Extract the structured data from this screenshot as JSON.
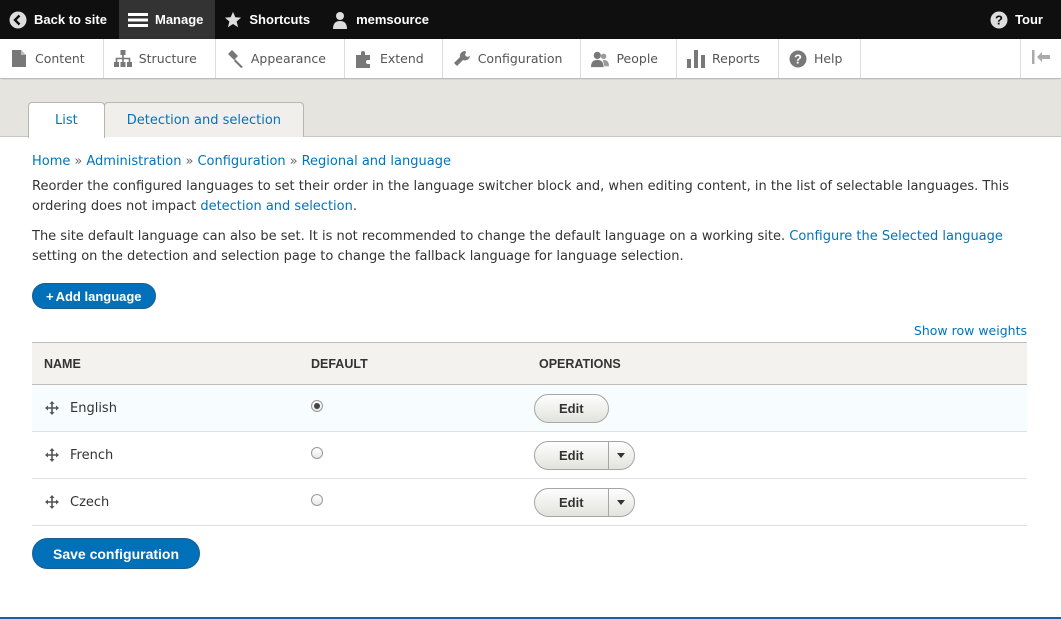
{
  "toolbar": {
    "back_label": "Back to site",
    "manage_label": "Manage",
    "shortcuts_label": "Shortcuts",
    "user_label": "memsource",
    "tour_label": "Tour"
  },
  "tray": {
    "items": [
      {
        "label": "Content",
        "icon": "file-icon"
      },
      {
        "label": "Structure",
        "icon": "sitemap-icon"
      },
      {
        "label": "Appearance",
        "icon": "brush-icon"
      },
      {
        "label": "Extend",
        "icon": "puzzle-icon"
      },
      {
        "label": "Configuration",
        "icon": "wrench-icon"
      },
      {
        "label": "People",
        "icon": "people-icon"
      },
      {
        "label": "Reports",
        "icon": "bar-chart-icon"
      },
      {
        "label": "Help",
        "icon": "help-icon"
      }
    ]
  },
  "tabs": [
    {
      "label": "List",
      "active": true
    },
    {
      "label": "Detection and selection",
      "active": false
    }
  ],
  "breadcrumb": [
    "Home",
    "Administration",
    "Configuration",
    "Regional and language"
  ],
  "intro": {
    "p1_text": "Reorder the configured languages to set their order in the language switcher block and, when editing content, in the list of selectable languages. This ordering does not impact ",
    "p1_link": "detection and selection",
    "p1_end": ".",
    "p2_text": "The site default language can also be set. It is not recommended to change the default language on a working site. ",
    "p2_link": "Configure the Selected language",
    "p2_end": " setting on the detection and selection page to change the fallback language for language selection."
  },
  "add_language_label": "Add language",
  "show_row_weights": "Show row weights",
  "table": {
    "headers": [
      "NAME",
      "DEFAULT",
      "OPERATIONS"
    ],
    "rows": [
      {
        "name": "English",
        "default": true,
        "op": "Edit",
        "has_dropdown": false
      },
      {
        "name": "French",
        "default": false,
        "op": "Edit",
        "has_dropdown": true
      },
      {
        "name": "Czech",
        "default": false,
        "op": "Edit",
        "has_dropdown": true
      }
    ]
  },
  "save_label": "Save configuration",
  "colors": {
    "toolbar_bg": "#0f0f0f",
    "link": "#0074bd",
    "primary_button": "#0071b8"
  }
}
